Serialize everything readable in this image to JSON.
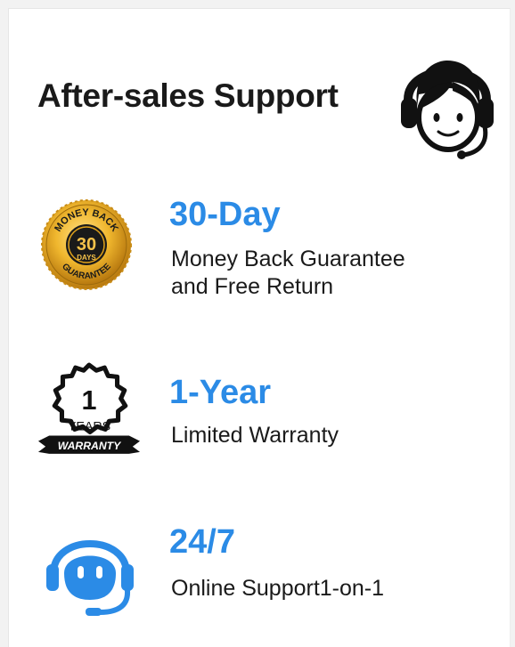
{
  "header": {
    "title": "After-sales Support",
    "icon": "customer-service-headset-icon"
  },
  "features": [
    {
      "badge_icon": "money-back-seal-icon",
      "badge_text_top": "MONEY BACK",
      "badge_number": "30",
      "badge_text_mid": "DAYS",
      "badge_text_bottom": "GUARANTEE",
      "headline": "30-Day",
      "description": "Money Back Guarantee\nand Free Return"
    },
    {
      "badge_icon": "warranty-badge-icon",
      "badge_number": "1",
      "badge_text_mid": "YEARS",
      "badge_ribbon": "WARRANTY",
      "headline": "1-Year",
      "description": "Limited Warranty"
    },
    {
      "badge_icon": "headset-support-icon",
      "headline": "24/7",
      "description": "Online Support1-on-1"
    }
  ],
  "colors": {
    "accent": "#2b8be6",
    "text": "#1a1a1a",
    "gold": "#e0a21a",
    "black": "#111111"
  }
}
